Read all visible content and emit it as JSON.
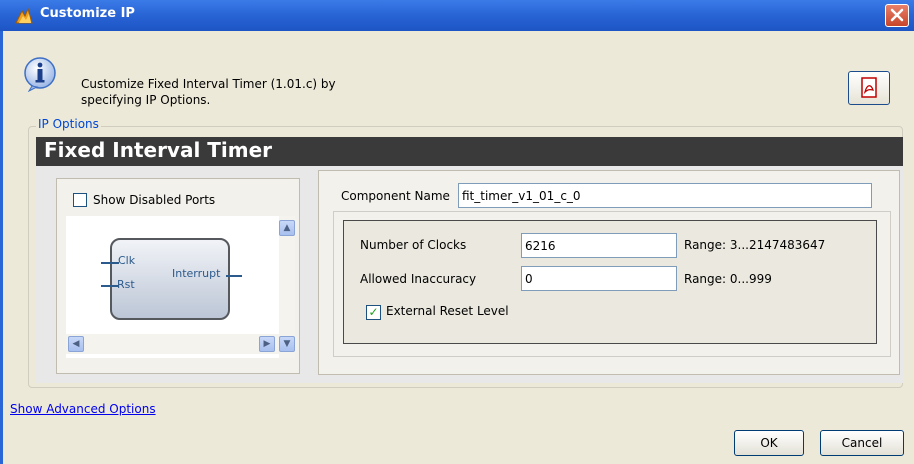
{
  "window": {
    "title": "Customize IP"
  },
  "header": {
    "description_line1": "Customize Fixed Interval Timer (1.01.c) by",
    "description_line2": "specifying IP Options."
  },
  "ip_options": {
    "group_label": "IP Options",
    "core_title": "Fixed Interval Timer",
    "show_disabled_ports_label": "Show Disabled Ports",
    "show_disabled_ports_checked": false,
    "block": {
      "ports_left": [
        "Clk",
        "Rst"
      ],
      "port_right": "Interrupt"
    },
    "component_name_label": "Component Name",
    "component_name_value": "fit_timer_v1_01_c_0",
    "params": [
      {
        "label": "Number of Clocks",
        "value": "6216",
        "range": "Range: 3...2147483647"
      },
      {
        "label": "Allowed Inaccuracy",
        "value": "0",
        "range": "Range: 0...999"
      }
    ],
    "external_reset_label": "External Reset Level",
    "external_reset_checked": true
  },
  "footer": {
    "advanced_link": "Show Advanced Options",
    "ok_label": "OK",
    "cancel_label": "Cancel"
  },
  "colors": {
    "titlebar": "#2a66d6",
    "banner": "#3a3a3a",
    "link": "#0000ee",
    "dialog_bg": "#ece9d8"
  }
}
